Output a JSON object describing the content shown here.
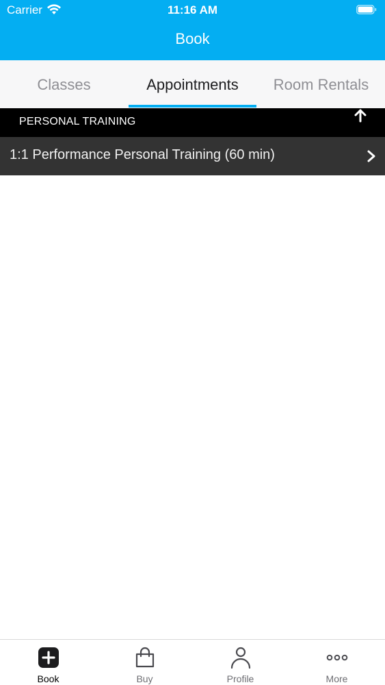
{
  "status_bar": {
    "carrier": "Carrier",
    "time": "11:16 AM"
  },
  "nav": {
    "title": "Book"
  },
  "tabs": [
    {
      "label": "Classes",
      "active": false
    },
    {
      "label": "Appointments",
      "active": true
    },
    {
      "label": "Room Rentals",
      "active": false
    }
  ],
  "section": {
    "title": "PERSONAL TRAINING"
  },
  "items": [
    {
      "label": "1:1 Performance Personal Training (60 min)"
    }
  ],
  "tab_bar": [
    {
      "label": "Book",
      "icon": "plus-square-icon",
      "active": true
    },
    {
      "label": "Buy",
      "icon": "shopping-bag-icon",
      "active": false
    },
    {
      "label": "Profile",
      "icon": "person-icon",
      "active": false
    },
    {
      "label": "More",
      "icon": "ellipsis-icon",
      "active": false
    }
  ],
  "colors": {
    "accent": "#04aef2",
    "header_bg": "#000000",
    "row_bg": "#333333"
  }
}
